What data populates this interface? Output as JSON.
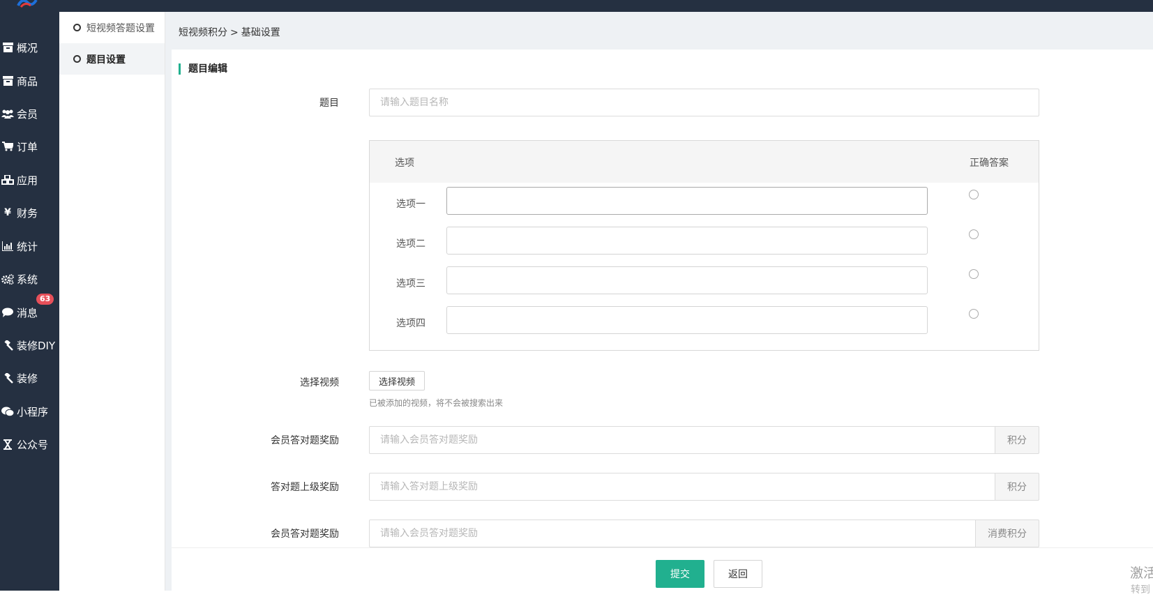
{
  "sidebar": {
    "items": [
      {
        "label": "概况",
        "icon": "archive-icon"
      },
      {
        "label": "商品",
        "icon": "box-icon"
      },
      {
        "label": "会员",
        "icon": "users-icon"
      },
      {
        "label": "订单",
        "icon": "cart-icon"
      },
      {
        "label": "应用",
        "icon": "cubes-icon"
      },
      {
        "label": "财务",
        "icon": "yen-icon"
      },
      {
        "label": "统计",
        "icon": "bar-chart-icon"
      },
      {
        "label": "系统",
        "icon": "gears-icon"
      },
      {
        "label": "消息",
        "icon": "comment-icon",
        "badge": "63"
      },
      {
        "label": "装修DIY",
        "icon": "gavel-icon"
      },
      {
        "label": "装修",
        "icon": "gavel-icon"
      },
      {
        "label": "小程序",
        "icon": "wechat-icon"
      },
      {
        "label": "公众号",
        "icon": "hourglass-icon"
      }
    ]
  },
  "subnav": {
    "items": [
      {
        "label": "短视频答题设置",
        "active": false
      },
      {
        "label": "题目设置",
        "active": true
      }
    ]
  },
  "breadcrumb": {
    "parent": "短视频积分",
    "separator": ">",
    "current": "基础设置"
  },
  "section": {
    "title": "题目编辑"
  },
  "form": {
    "question": {
      "label": "题目",
      "placeholder": "请输入题目名称"
    },
    "options_table": {
      "col_option": "选项",
      "col_correct": "正确答案",
      "rows": [
        {
          "label": "选项一",
          "value": ""
        },
        {
          "label": "选项二",
          "value": ""
        },
        {
          "label": "选项三",
          "value": ""
        },
        {
          "label": "选项四",
          "value": ""
        }
      ]
    },
    "video": {
      "label": "选择视频",
      "button": "选择视频",
      "hint": "已被添加的视频，将不会被搜索出来"
    },
    "member_reward": {
      "label": "会员答对题奖励",
      "placeholder": "请输入会员答对题奖励",
      "addon": "积分"
    },
    "parent_reward": {
      "label": "答对题上级奖励",
      "placeholder": "请输入答对题上级奖励",
      "addon": "积分"
    },
    "member_consume_reward": {
      "label": "会员答对题奖励",
      "placeholder": "请输入会员答对题奖励",
      "addon": "消费积分"
    }
  },
  "footer": {
    "submit": "提交",
    "back": "返回"
  },
  "watermark": {
    "line1": "激活",
    "line2": "转到"
  },
  "colors": {
    "sidebar_bg": "#253041",
    "accent": "#21b08f",
    "badge": "#e7505a"
  }
}
